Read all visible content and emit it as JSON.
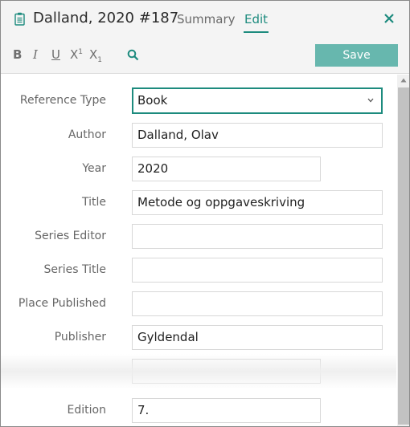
{
  "header": {
    "title": "Dalland, 2020 #187",
    "tabs": [
      {
        "label": "Summary"
      },
      {
        "label": "Edit"
      }
    ],
    "active_tab": "Edit",
    "doc_icon": "clipboard-icon",
    "close_icon": "close-icon"
  },
  "toolbar": {
    "bold": "B",
    "italic": "I",
    "underline": "U",
    "superscript": "X",
    "superscript_mark": "1",
    "subscript": "X",
    "subscript_mark": "1",
    "search_icon": "search-icon",
    "save_label": "Save"
  },
  "form": {
    "fields": [
      {
        "label": "Reference Type",
        "value": "Book"
      },
      {
        "label": "Author",
        "value": "Dalland, Olav"
      },
      {
        "label": "Year",
        "value": "2020"
      },
      {
        "label": "Title",
        "value": "Metode og oppgaveskriving"
      },
      {
        "label": "Series Editor",
        "value": ""
      },
      {
        "label": "Series Title",
        "value": ""
      },
      {
        "label": "Place Published",
        "value": ""
      },
      {
        "label": "Publisher",
        "value": "Gyldendal"
      },
      {
        "label": "",
        "value": ""
      },
      {
        "label": "Edition",
        "value": "7."
      }
    ]
  },
  "colors": {
    "accent": "#1d8b7e",
    "save_button": "#67b7ae",
    "header_bg": "#f4f4f4"
  }
}
